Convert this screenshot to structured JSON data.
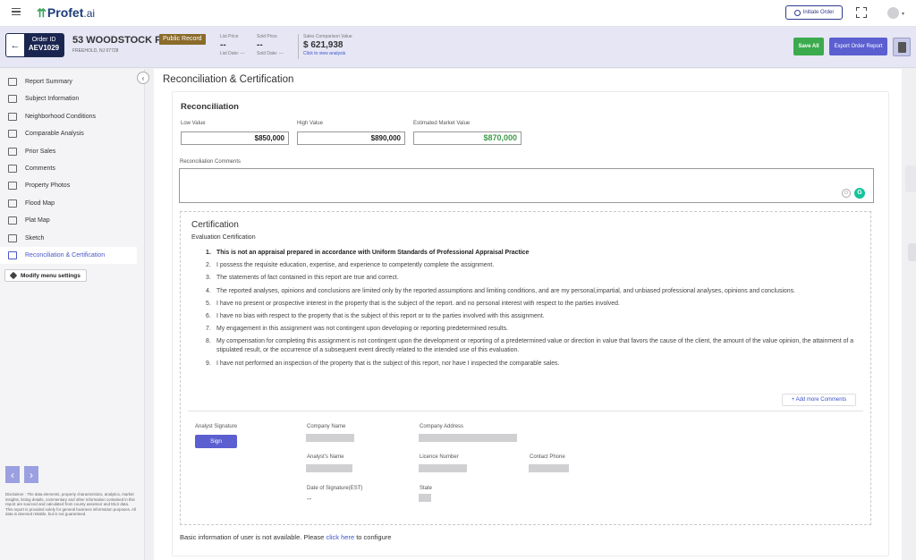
{
  "app": {
    "logo": "Profet",
    "logo_suffix": ".ai"
  },
  "topbar": {
    "initiate_label": "Initiate Order"
  },
  "order": {
    "id_label": "Order ID",
    "id_value": "AEV1029",
    "address": "53 WOODSTOCK PL",
    "city": "FREEHOLD, NJ 07728",
    "record_badge": "Public Record",
    "list_price_label": "List Price",
    "list_price_value": "--",
    "list_date": "List Date: ---",
    "sold_price_label": "Sold Price",
    "sold_price_value": "--",
    "sold_date": "Sold Date: ---",
    "scv_label": "Sales Comparison Value",
    "scv_value": "$ 621,938",
    "scv_link": "Click to view analysis",
    "save_all": "Save All",
    "export": "Export Order Report"
  },
  "sidebar": {
    "items": [
      {
        "label": "Report Summary",
        "icon": "report-icon"
      },
      {
        "label": "Subject Information",
        "icon": "home-icon"
      },
      {
        "label": "Neighborhood Conditions",
        "icon": "neighborhood-icon"
      },
      {
        "label": "Comparable Analysis",
        "icon": "bank-icon"
      },
      {
        "label": "Prior Sales",
        "icon": "history-icon"
      },
      {
        "label": "Comments",
        "icon": "comment-icon"
      },
      {
        "label": "Property Photos",
        "icon": "photo-icon"
      },
      {
        "label": "Flood Map",
        "icon": "flood-icon"
      },
      {
        "label": "Plat Map",
        "icon": "plat-icon"
      },
      {
        "label": "Sketch",
        "icon": "sketch-icon"
      },
      {
        "label": "Reconciliation & Certification",
        "icon": "certification-icon"
      }
    ],
    "active_index": 10,
    "modify_label": "Modify menu settings",
    "disclaimer": "Disclaimer : The data elements, property characteristics, analytics, market insights, listing details, commentary and other information contained in this report are sourced and calculated from county assessor and MLS data. This report is provided solely for general business information purposes. All data is deemed reliable, but is not guaranteed."
  },
  "main": {
    "title": "Reconciliation & Certification",
    "reconciliation": {
      "heading": "Reconciliation",
      "low_label": "Low Value",
      "low_value": "$850,000",
      "high_label": "High Value",
      "high_value": "$890,000",
      "est_label": "Estimated Market Value",
      "est_value": "$870,000",
      "comments_label": "Reconciliation Comments"
    },
    "certification": {
      "heading": "Certification",
      "sub": "Evaluation Certification",
      "items": [
        "This is not an appraisal prepared in accordance with Uniform Standards of Professional Appraisal Practice",
        "I possess the requisite education, expertise, and experience to competently complete the assignment.",
        "The statements of fact contained in this report are true and correct.",
        "The reported analyses, opinions and conclusions are limited only by the reported assumptions and limiting conditions, and are my personal,impartial, and unbiased professional analyses, opinions and conclusions.",
        "I have no present or prospective interest in the property that is the subject of the report. and no personal interest with respect to the parties involved.",
        "I have no bias with respect to the property that is the subject of this report or to the parties involved with this assignment.",
        "My engagement in this assignment was not contingent upon developing or reporting predetermined results.",
        "My compensation for completing this assignment is not contingent upon the development or reporting of a predetermined value or direction in value that favors the cause of the client, the amount of the value opinion, the attainment of a stipulated result, or the occurrence of a subsequent event directly related to the intended use of this evaluation.",
        "I have not performed an inspection of the property that is the subject of this report, nor have I inspected the comparable sales."
      ],
      "add_more": "+ Add more Comments",
      "analyst_signature": "Analyst Signature",
      "sign": "Sign",
      "company_name": "Company Name",
      "company_address": "Company Address",
      "analyst_name": "Analyst's Name",
      "licence_number": "Licence Number",
      "contact_phone": "Contact Phone",
      "date_of_signature": "Date of Signature(EST)",
      "date_value": "--",
      "state": "State"
    },
    "footer_text": "Basic information of user is not available. Please",
    "footer_link": "click here",
    "footer_tail": "to configure"
  }
}
